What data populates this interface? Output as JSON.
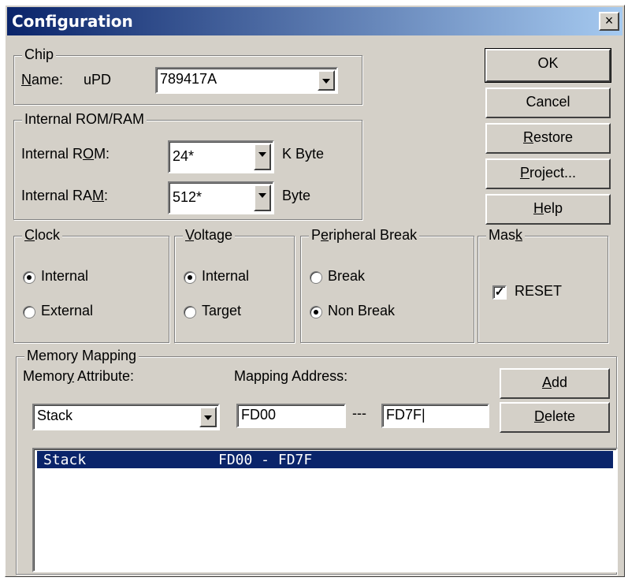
{
  "window": {
    "title": "Configuration",
    "close": "×"
  },
  "chip": {
    "group": "Chip",
    "name_label": "Name:",
    "prefix": "uPD",
    "value": "789417A"
  },
  "rom_ram": {
    "group": "Internal ROM/RAM",
    "rom_label": "Internal ROM:",
    "rom_value": "24*",
    "rom_unit": "K Byte",
    "ram_label": "Internal RAM:",
    "ram_value": "512*",
    "ram_unit": "Byte"
  },
  "buttons": {
    "ok": "OK",
    "cancel": "Cancel",
    "restore": "Restore",
    "project": "Project...",
    "help": "Help",
    "add": "Add",
    "delete": "Delete"
  },
  "clock": {
    "group": "Clock",
    "options": [
      "Internal",
      "External"
    ],
    "selected": 0
  },
  "voltage": {
    "group": "Voltage",
    "options": [
      "Internal",
      "Target"
    ],
    "selected": 0
  },
  "peripheral": {
    "group": "Peripheral Break",
    "options": [
      "Break",
      "Non Break"
    ],
    "selected": 1
  },
  "mask": {
    "group": "Mask",
    "reset_label": "RESET",
    "reset_checked": true
  },
  "memory": {
    "group": "Memory Mapping",
    "attr_label": "Memory Attribute:",
    "attr_value": "Stack",
    "addr_label": "Mapping Address:",
    "addr_from": "FD00",
    "separator": "---",
    "addr_to": "FD7F|",
    "list": [
      {
        "attr": "Stack",
        "range": "FD00 - FD7F"
      }
    ]
  }
}
